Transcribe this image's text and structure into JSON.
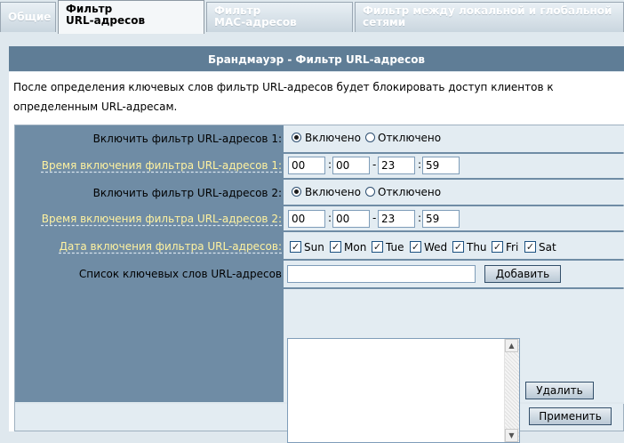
{
  "tabs": [
    {
      "label": "Общие"
    },
    {
      "label_line1": "Фильтр",
      "label_line2": "URL-адресов"
    },
    {
      "label_line1": "Фильтр",
      "label_line2": "MAC-адресов"
    },
    {
      "label_line1": "Фильтр между локальной и глобальной",
      "label_line2": "сетями"
    }
  ],
  "panel": {
    "title": "Брандмауэр - Фильтр URL-адресов",
    "description": "После определения ключевых слов фильтр URL-адресов будет блокировать доступ клиентов к определенным URL-адресам."
  },
  "form": {
    "enable1_label": "Включить фильтр URL-адресов 1:",
    "enable1_on": "Включено",
    "enable1_off": "Отключено",
    "time1_label": "Время включения фильтра URL-адресов 1:",
    "time1": {
      "start_h": "00",
      "start_m": "00",
      "end_h": "23",
      "end_m": "59"
    },
    "enable2_label": "Включить фильтр URL-адресов 2:",
    "enable2_on": "Включено",
    "enable2_off": "Отключено",
    "time2_label": "Время включения фильтра URL-адресов 2:",
    "time2": {
      "start_h": "00",
      "start_m": "00",
      "end_h": "23",
      "end_m": "59"
    },
    "date_label": "Дата включения фильтра URL-адресов:",
    "days": [
      "Sun",
      "Mon",
      "Tue",
      "Wed",
      "Thu",
      "Fri",
      "Sat"
    ],
    "keyword_label": "Список ключевых слов URL-адресов",
    "keyword_value": "",
    "add_button": "Добавить",
    "delete_button": "Удалить",
    "apply_button": "Применить",
    "separator_colon": ":",
    "separator_dash": "-"
  }
}
